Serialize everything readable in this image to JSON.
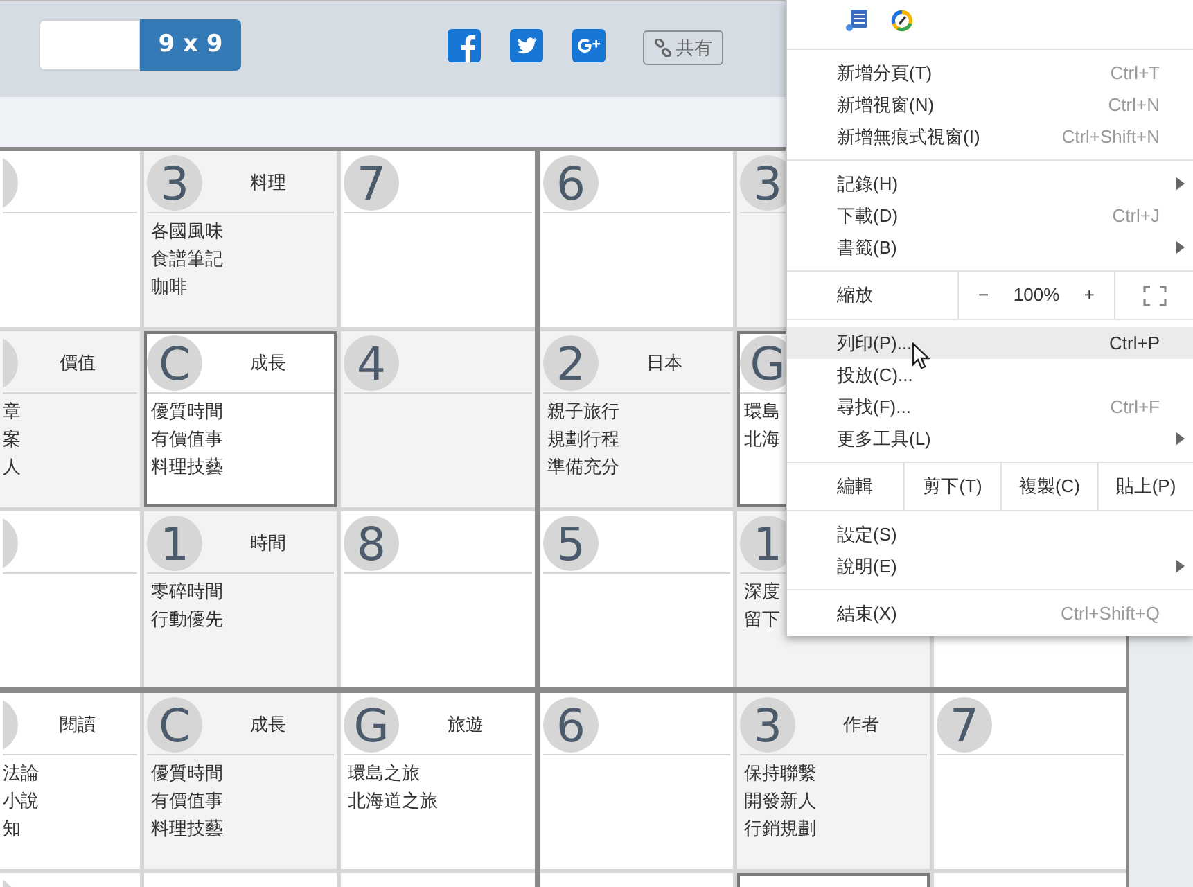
{
  "toolbar": {
    "size_button": "9 x 9",
    "social": [
      {
        "kind": "facebook"
      },
      {
        "kind": "twitter"
      },
      {
        "kind": "google"
      }
    ],
    "share_button": "共有"
  },
  "grid": {
    "block_rows": [
      {
        "rows": [
          [
            {
              "cut": true,
              "shaded": false,
              "highlighted": false
            },
            {
              "number": "3",
              "label": "料理",
              "items": [
                "各國風味",
                "食譜筆記",
                "咖啡"
              ],
              "shaded": true,
              "highlighted": false
            },
            {
              "number": "7",
              "shaded": false,
              "highlighted": false
            },
            {
              "number": "6",
              "shaded": false,
              "highlighted": false
            },
            {
              "number": "3",
              "shaded": true,
              "highlighted": false
            }
          ],
          [
            {
              "cut": true,
              "label": "價值",
              "items": [
                "章",
                "案",
                "人"
              ],
              "shaded": true,
              "highlighted": false
            },
            {
              "number": "C",
              "label": "成長",
              "items": [
                "優質時間",
                "有價值事",
                "料理技藝"
              ],
              "shaded": false,
              "highlighted": true
            },
            {
              "number": "4",
              "shaded": true,
              "highlighted": false
            },
            {
              "number": "2",
              "label": "日本",
              "items": [
                "親子旅行",
                "規劃行程",
                "準備充分"
              ],
              "shaded": true,
              "highlighted": false
            },
            {
              "number": "G",
              "items": [
                "環島",
                "北海"
              ],
              "shaded": false,
              "highlighted": true
            }
          ],
          [
            {
              "cut": true,
              "shaded": false,
              "highlighted": false
            },
            {
              "number": "1",
              "label": "時間",
              "items": [
                "零碎時間",
                "行動優先"
              ],
              "shaded": true,
              "highlighted": false
            },
            {
              "number": "8",
              "shaded": false,
              "highlighted": false
            },
            {
              "number": "5",
              "shaded": false,
              "highlighted": false
            },
            {
              "number": "1",
              "items": [
                "深度",
                "留下"
              ],
              "shaded": true,
              "highlighted": false
            }
          ]
        ]
      },
      {
        "rows": [
          [
            {
              "cut": true,
              "label": "閱讀",
              "items": [
                "法論",
                "小說",
                "知"
              ],
              "shaded": false,
              "highlighted": false
            },
            {
              "number": "C",
              "label": "成長",
              "items": [
                "優質時間",
                "有價值事",
                "料理技藝"
              ],
              "shaded": true,
              "highlighted": false
            },
            {
              "number": "G",
              "label": "旅遊",
              "items": [
                "環島之旅",
                "北海道之旅"
              ],
              "shaded": false,
              "highlighted": false
            },
            {
              "number": "6",
              "shaded": false,
              "highlighted": false
            },
            {
              "number": "3",
              "label": "作者",
              "items": [
                "保持聯繫",
                "開發新人",
                "行銷規劃"
              ],
              "shaded": true,
              "highlighted": false
            },
            {
              "number": "7",
              "shaded": false,
              "highlighted": false
            }
          ],
          [
            {
              "cut": true,
              "highlighted": false
            },
            {
              "highlighted": false
            },
            {
              "highlighted": false
            },
            {
              "highlighted": false
            },
            {
              "highlighted": true
            },
            {
              "highlighted": false
            }
          ]
        ]
      }
    ]
  },
  "menu": {
    "sections": [
      [
        {
          "kind": "icons"
        }
      ],
      [
        {
          "kind": "item",
          "label": "新增分頁(T)",
          "shortcut": "Ctrl+T",
          "submenu": false,
          "selected": false
        },
        {
          "kind": "item",
          "label": "新增視窗(N)",
          "shortcut": "Ctrl+N",
          "submenu": false,
          "selected": false
        },
        {
          "kind": "item",
          "label": "新增無痕式視窗(I)",
          "shortcut": "Ctrl+Shift+N",
          "submenu": false,
          "selected": false
        }
      ],
      [
        {
          "kind": "item",
          "label": "記錄(H)",
          "submenu": true,
          "selected": false
        },
        {
          "kind": "item",
          "label": "下載(D)",
          "shortcut": "Ctrl+J",
          "submenu": false,
          "selected": false
        },
        {
          "kind": "item",
          "label": "書籤(B)",
          "submenu": true,
          "selected": false
        }
      ],
      [
        {
          "kind": "zoom",
          "label": "縮放",
          "minus": "−",
          "value": "100%",
          "plus": "+"
        }
      ],
      [
        {
          "kind": "item",
          "label": "列印(P)...",
          "shortcut": "Ctrl+P",
          "submenu": false,
          "selected": true
        },
        {
          "kind": "item",
          "label": "投放(C)...",
          "submenu": false,
          "selected": false
        },
        {
          "kind": "item",
          "label": "尋找(F)...",
          "shortcut": "Ctrl+F",
          "submenu": false,
          "selected": false
        },
        {
          "kind": "item",
          "label": "更多工具(L)",
          "submenu": true,
          "selected": false
        }
      ],
      [
        {
          "kind": "edit",
          "label": "編輯",
          "actions": [
            "剪下(T)",
            "複製(C)",
            "貼上(P)"
          ]
        }
      ],
      [
        {
          "kind": "item",
          "label": "設定(S)",
          "submenu": false,
          "selected": false
        },
        {
          "kind": "item",
          "label": "說明(E)",
          "submenu": true,
          "selected": false
        }
      ],
      [
        {
          "kind": "item",
          "label": "結束(X)",
          "shortcut": "Ctrl+Shift+Q",
          "submenu": false,
          "selected": false
        }
      ]
    ]
  }
}
